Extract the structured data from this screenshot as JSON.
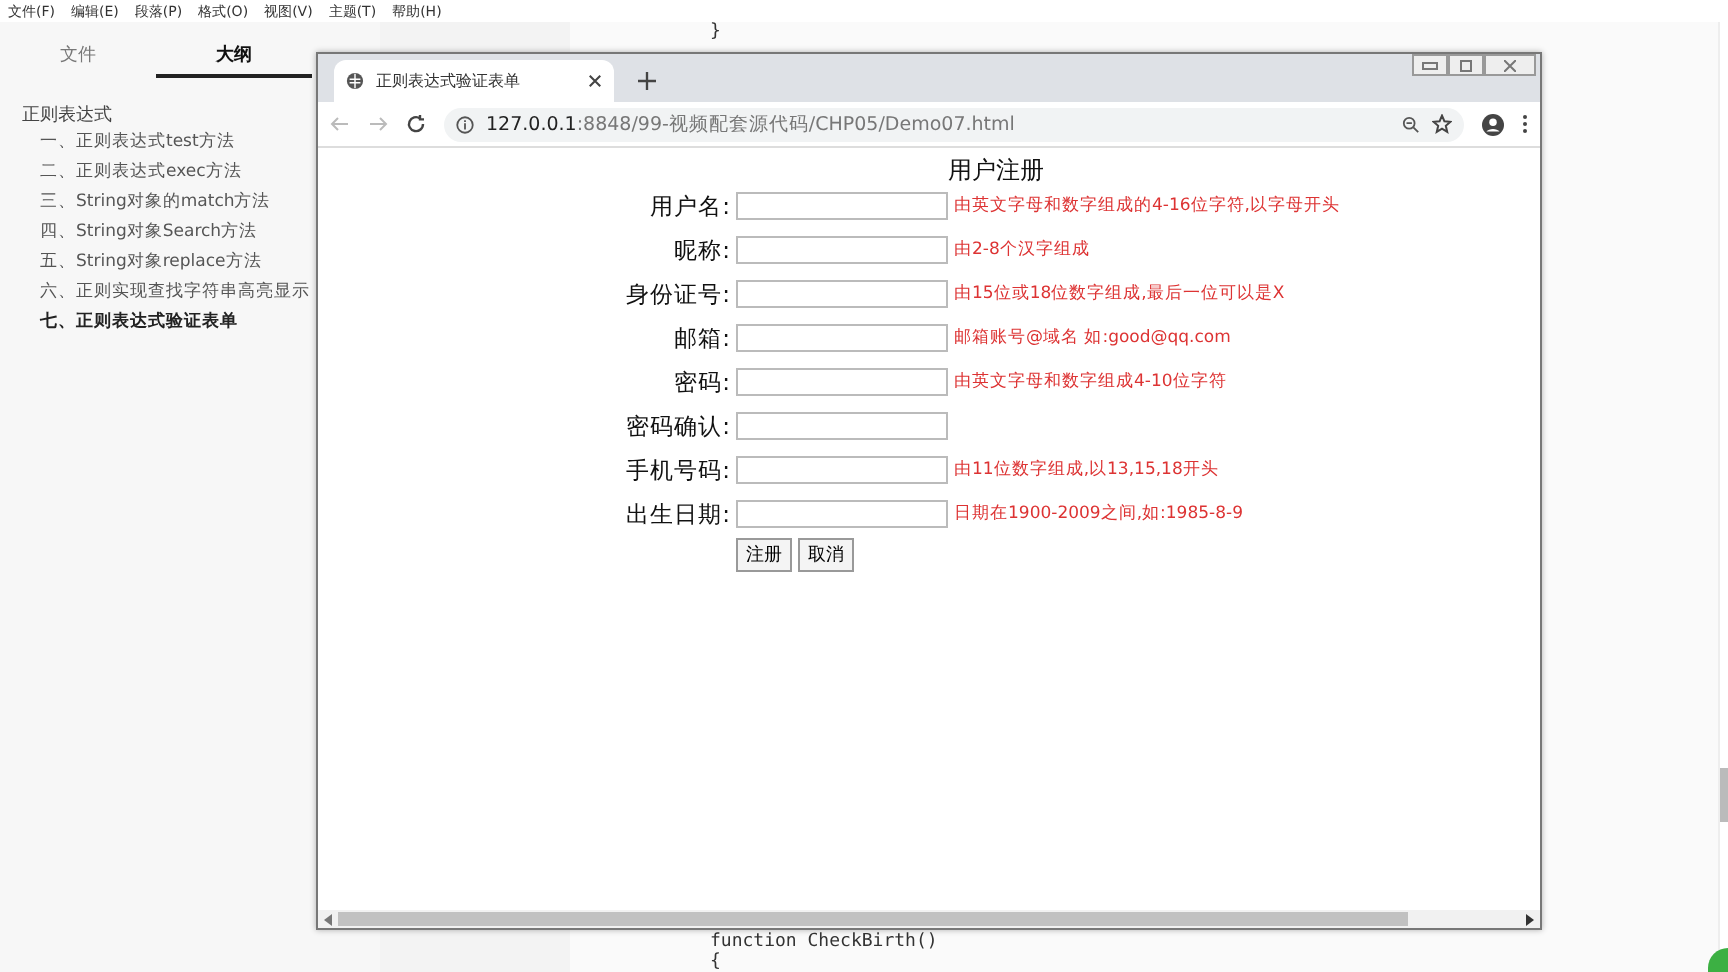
{
  "editor": {
    "menu": [
      "文件(F)",
      "编辑(E)",
      "段落(P)",
      "格式(O)",
      "视图(V)",
      "主题(T)",
      "帮助(H)"
    ],
    "sidebar_tabs": [
      {
        "label": "文件",
        "selected": false
      },
      {
        "label": "大纲",
        "selected": true
      }
    ],
    "outline": {
      "label": "正则表达式",
      "children": [
        {
          "label": "一、正则表达式test方法",
          "selected": false
        },
        {
          "label": "二、正则表达式exec方法",
          "selected": false
        },
        {
          "label": "三、String对象的match方法",
          "selected": false
        },
        {
          "label": "四、String对象Search方法",
          "selected": false
        },
        {
          "label": "五、String对象replace方法",
          "selected": false
        },
        {
          "label": "六、正则实现查找字符串高亮显示",
          "selected": false
        },
        {
          "label": "七、正则表达式验证表单",
          "selected": true
        }
      ]
    },
    "code_top": [
      "}"
    ],
    "code_bottom": [
      "function CheckBirth()",
      "{"
    ]
  },
  "browser": {
    "tab_title": "正则表达式验证表单",
    "url_host": "127.0.0.1",
    "url_path": ":8848/99-视频配套源代码/CHP05/Demo07.html",
    "form": {
      "title": "用户注册",
      "fields": [
        {
          "label": "用户名:",
          "hint": "由英文字母和数字组成的4-16位字符,以字母开头"
        },
        {
          "label": "昵称:",
          "hint": "由2-8个汉字组成"
        },
        {
          "label": "身份证号:",
          "hint": "由15位或18位数字组成,最后一位可以是X"
        },
        {
          "label": "邮箱:",
          "hint": "邮箱账号@域名 如:good@qq.com"
        },
        {
          "label": "密码:",
          "hint": "由英文字母和数字组成4-10位字符"
        },
        {
          "label": "密码确认:"
        },
        {
          "label": "手机号码:",
          "hint": "由11位数字组成,以13,15,18开头"
        },
        {
          "label": "出生日期:",
          "hint": "日期在1900-2009之间,如:1985-8-9"
        }
      ],
      "buttons": [
        "注册",
        "取消"
      ]
    }
  }
}
